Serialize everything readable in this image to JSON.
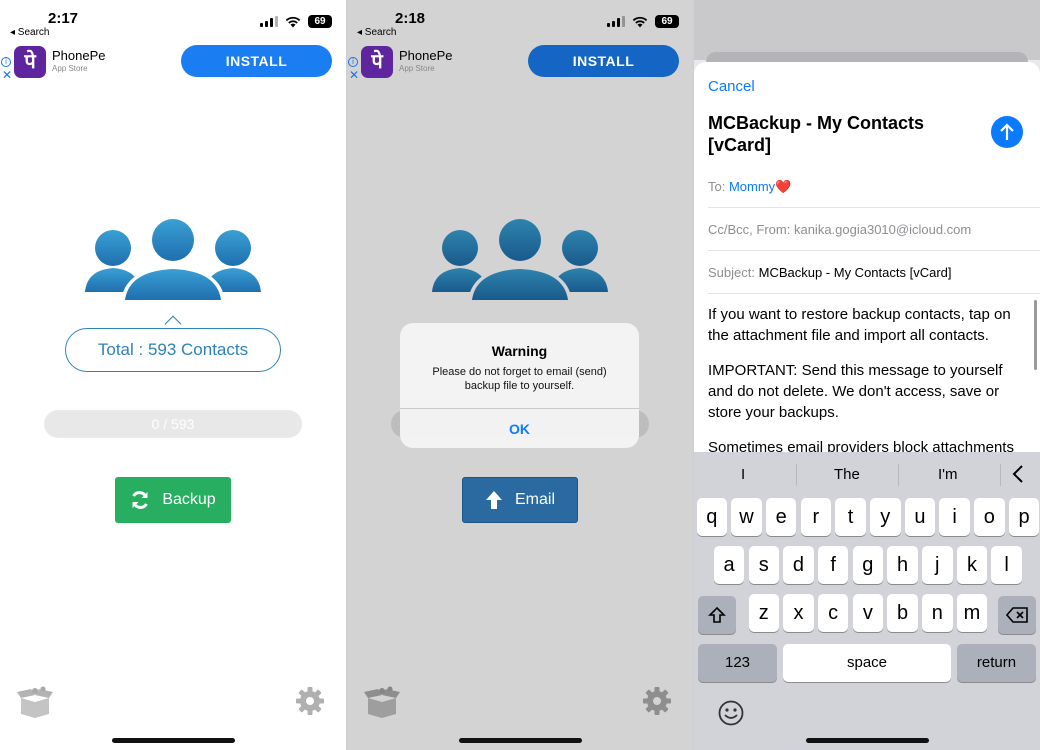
{
  "panel1": {
    "status": {
      "time": "2:17",
      "back": "◂ Search",
      "battery": "69"
    },
    "ad": {
      "app_name": "PhonePe",
      "store": "App Store",
      "install": "INSTALL",
      "icon_glyph": "पे"
    },
    "total_label": "Total : 593 Contacts",
    "progress": {
      "text": "0 / 593",
      "done": 0,
      "total": 593
    },
    "backup_button": "Backup"
  },
  "panel2": {
    "status": {
      "time": "2:18",
      "back": "◂ Search",
      "battery": "69"
    },
    "ad": {
      "app_name": "PhonePe",
      "store": "App Store",
      "install": "INSTALL",
      "icon_glyph": "पे"
    },
    "dialog": {
      "title": "Warning",
      "message": "Please do not forget to email (send) backup file to yourself.",
      "ok": "OK"
    },
    "email_button": "Email"
  },
  "panel3": {
    "cancel": "Cancel",
    "title": "MCBackup - My Contacts [vCard]",
    "to_label": "To:",
    "to_value": "Mommy❤️",
    "cc_label": "Cc/Bcc, From:",
    "cc_value": "kanika.gogia3010@icloud.com",
    "subject_label": "Subject:",
    "subject_value": "MCBackup - My Contacts [vCard]",
    "body": [
      "If you want to restore backup contacts, tap on the attachment file and import all contacts.",
      "IMPORTANT: Send this message to yourself and do not delete. We don't access, save or store your backups.",
      "Sometimes email providers block attachments"
    ],
    "keyboard": {
      "suggestions": [
        "I",
        "The",
        "I'm"
      ],
      "row1": [
        "q",
        "w",
        "e",
        "r",
        "t",
        "y",
        "u",
        "i",
        "o",
        "p"
      ],
      "row2": [
        "a",
        "s",
        "d",
        "f",
        "g",
        "h",
        "j",
        "k",
        "l"
      ],
      "row3": [
        "z",
        "x",
        "c",
        "v",
        "b",
        "n",
        "m"
      ],
      "numbers_key": "123",
      "space_key": "space",
      "return_key": "return"
    }
  },
  "colors": {
    "accent_blue": "#0a7aff",
    "install_blue": "#1a7ef2",
    "backup_green": "#27ae60",
    "email_blue": "#2a6aa0",
    "contacts_blue": "#2d83b8",
    "phonepe_purple": "#5f259f"
  }
}
